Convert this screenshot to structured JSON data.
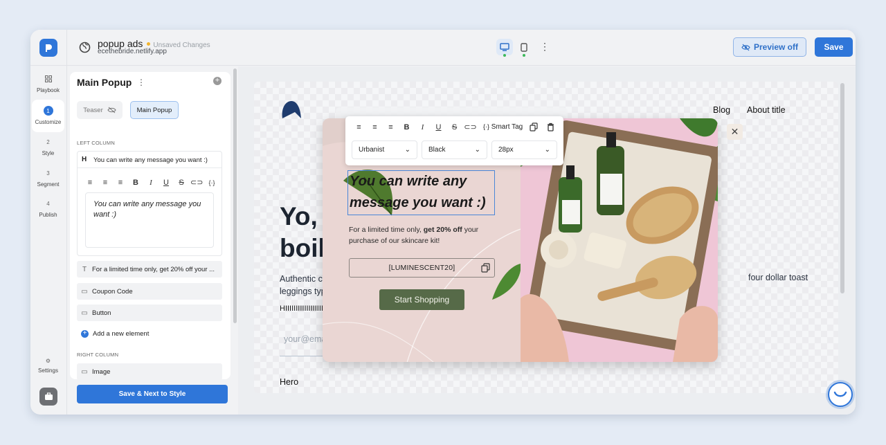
{
  "header": {
    "title": "popup ads",
    "status": "Unsaved Changes",
    "url": "ecethebride.netlify.app",
    "preview_label": "Preview off",
    "save_label": "Save"
  },
  "nav": {
    "items": [
      {
        "icon": "grid-icon",
        "num": "",
        "label": "Playbook"
      },
      {
        "icon": "",
        "num": "1",
        "label": "Customize"
      },
      {
        "icon": "",
        "num": "2",
        "label": "Style"
      },
      {
        "icon": "",
        "num": "3",
        "label": "Segment"
      },
      {
        "icon": "",
        "num": "4",
        "label": "Publish"
      }
    ],
    "settings_label": "Settings"
  },
  "panel": {
    "title": "Main Popup",
    "tabs": {
      "teaser": "Teaser",
      "main": "Main Popup"
    },
    "left_column_label": "LEFT COLUMN",
    "heading_element": {
      "type": "H",
      "label": "You can write any message you want :)"
    },
    "editor_text": "You can write any message you want :)",
    "elements": [
      {
        "icon": "T",
        "label": "For a limited time only, get 20% off your ..."
      },
      {
        "icon": "coupon-icon",
        "label": "Coupon Code"
      },
      {
        "icon": "button-icon",
        "label": "Button"
      }
    ],
    "add_element": "Add a new element",
    "right_column_label": "RIGHT COLUMN",
    "right_elements": [
      {
        "label": "Image"
      }
    ],
    "save_next": "Save & Next to Style"
  },
  "site": {
    "nav_links": [
      "Blog",
      "About title"
    ],
    "hero_heading_line1": "Yo, I'm",
    "hero_heading_line2": "boilerp",
    "hero_text_line1": "Authentic cred hood",
    "hero_text_line2": "leggings typewriter",
    "hero_text_right": "four dollar toast",
    "hero_small": "HIIIIIIIIIIIIIIIIIIIIIII",
    "email_placeholder": "your@email.com",
    "hero_image_alt": "Hero"
  },
  "popup": {
    "message": "You can write any message you want :)",
    "subtext_before": "For a limited time only,",
    "subtext_bold": "get 20% off",
    "subtext_after": "your purchase of our skincare kit!",
    "coupon": "[LUMINESCENT20]",
    "button": "Start Shopping"
  },
  "toolbar": {
    "smart_tag": "Smart Tag",
    "font": "Urbanist",
    "color": "Black",
    "size": "28px"
  },
  "colors": {
    "accent": "#2f76d9",
    "popup_button": "#566a48",
    "popup_bg": "#ead6d3"
  }
}
